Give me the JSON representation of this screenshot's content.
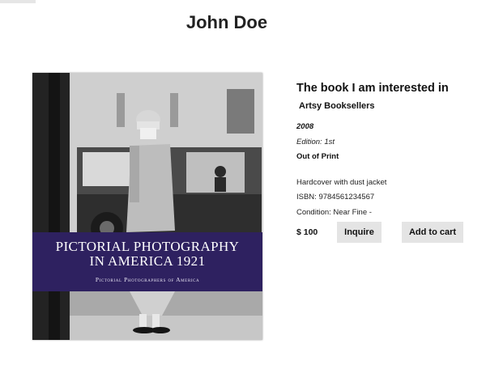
{
  "page": {
    "title": "John Doe"
  },
  "cover": {
    "title": "PICTORIAL PHOTOGRAPHY\nIN AMERICA 1921",
    "subtitle": "Pictorial Photographers of America"
  },
  "book": {
    "heading": "The book I am interested in",
    "seller": "Artsy Booksellers",
    "year": "2008",
    "edition": "Edition: 1st",
    "availability": "Out of Print",
    "binding": "Hardcover with dust jacket",
    "isbn": "ISBN: 9784561234567",
    "condition": "Condition: Near Fine -",
    "price": "$ 100"
  },
  "actions": {
    "inquire_label": "Inquire",
    "cart_label": "Add to cart"
  }
}
